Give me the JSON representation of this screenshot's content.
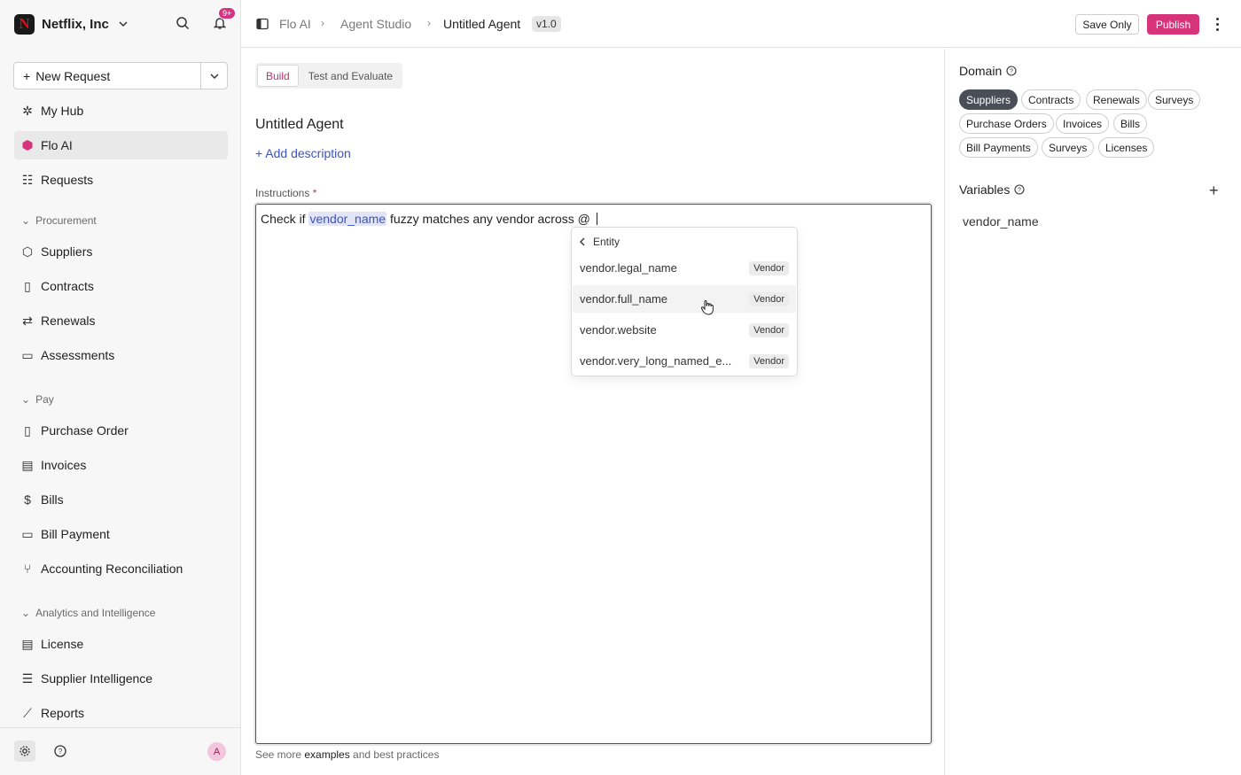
{
  "sidebar": {
    "org_name": "Netflix, Inc",
    "org_logo_letter": "N",
    "notifications_badge": "9+",
    "new_request_label": "New Request",
    "items_top": [
      {
        "label": "My Hub",
        "icon": "hub-icon"
      },
      {
        "label": "Flo AI",
        "icon": "flo-ai-icon"
      },
      {
        "label": "Requests",
        "icon": "list-icon"
      }
    ],
    "sections": [
      {
        "title": "Procurement",
        "items": [
          "Suppliers",
          "Contracts",
          "Renewals",
          "Assessments"
        ]
      },
      {
        "title": "Pay",
        "items": [
          "Purchase Order",
          "Invoices",
          "Bills",
          "Bill Payment",
          "Accounting Reconciliation"
        ]
      },
      {
        "title": "Analytics and Intelligence",
        "items": [
          "License",
          "Supplier Intelligence",
          "Reports"
        ]
      }
    ],
    "avatar_initial": "A"
  },
  "topbar": {
    "breadcrumbs": [
      "Flo AI",
      "Agent Studio",
      "Untitled Agent"
    ],
    "version": "v1.0",
    "save_label": "Save Only",
    "publish_label": "Publish"
  },
  "main": {
    "tabs": [
      "Build",
      "Test and Evaluate"
    ],
    "active_tab": "Build",
    "agent_title": "Untitled Agent",
    "add_description": "+ Add description",
    "instructions_label": "Instructions",
    "required_mark": "*",
    "instruction_text": {
      "before": "Check if ",
      "variable": "vendor_name",
      "after": " fuzzy matches any vendor across @ "
    },
    "help": {
      "prefix": "See more ",
      "link": "examples",
      "suffix": " and best practices"
    }
  },
  "dropdown": {
    "header": "Entity",
    "items": [
      {
        "name": "vendor.legal_name",
        "tag": "Vendor"
      },
      {
        "name": "vendor.full_name",
        "tag": "Vendor"
      },
      {
        "name": "vendor.website",
        "tag": "Vendor"
      },
      {
        "name": "vendor.very_long_named_e...",
        "tag": "Vendor"
      }
    ]
  },
  "right_panel": {
    "domain_label": "Domain",
    "domains": [
      "Suppliers",
      "Contracts",
      "Renewals",
      "Surveys",
      "Purchase Orders",
      "Invoices",
      "Bills",
      "Bill Payments",
      "Surveys",
      "Licenses"
    ],
    "selected_domain": "Suppliers",
    "variables_label": "Variables",
    "variables": [
      "vendor_name"
    ]
  },
  "colors": {
    "accent": "#d6337a",
    "link": "#3b54c4",
    "selected_pill": "#4a4f57"
  }
}
